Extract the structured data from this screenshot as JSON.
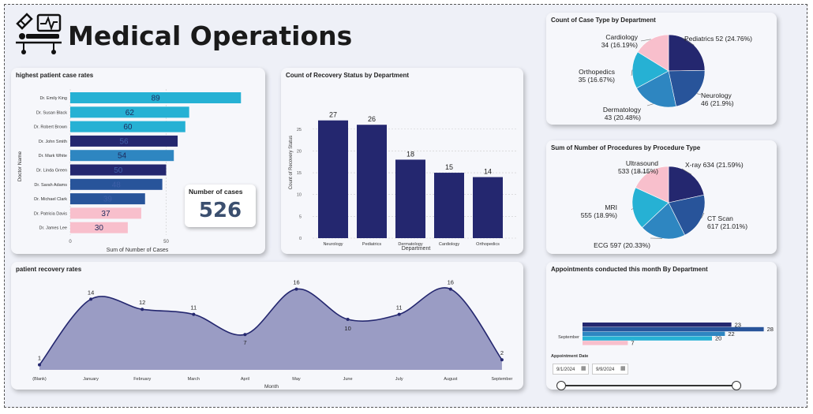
{
  "header": {
    "title": "Medical Operations"
  },
  "kpi": {
    "label": "Number of cases",
    "value": "526"
  },
  "slicer": {
    "label": "Appointment Date",
    "start": "9/1/2024",
    "end": "9/9/2024"
  },
  "colors": {
    "navy": "#24276f",
    "blue": "#28549a",
    "midblue": "#2e86c1",
    "cyan": "#26b1d4",
    "pink": "#f8bfcc",
    "area": "#9a9cc4"
  },
  "chart_data": [
    {
      "id": "cases_by_doctor",
      "type": "bar",
      "orientation": "horizontal",
      "title": "highest patient case rates",
      "xlabel": "Sum of Number of Cases",
      "ylabel": "Doctor Name",
      "xticks": [
        "0",
        "50"
      ],
      "categories": [
        "Dr. Emily King",
        "Dr. Susan Black",
        "Dr. Robert Brown",
        "Dr. John Smith",
        "Dr. Mark White",
        "Dr. Linda Green",
        "Dr. Sarah Adams",
        "Dr. Michael Clark",
        "Dr. Patricia Davis",
        "Dr. James Lee"
      ],
      "values": [
        89,
        62,
        60,
        56,
        54,
        50,
        48,
        39,
        37,
        30
      ],
      "colors": [
        "#26b1d4",
        "#26b1d4",
        "#26b1d4",
        "#24276f",
        "#2e86c1",
        "#24276f",
        "#28549a",
        "#28549a",
        "#f8bfcc",
        "#f8bfcc"
      ]
    },
    {
      "id": "recovery_by_dept",
      "type": "bar",
      "title": "Count of Recovery Status by Department",
      "xlabel": "Department",
      "ylabel": "Count of Recovery Status",
      "categories": [
        "Neurology",
        "Pediatrics",
        "Dermatology",
        "Cardiology",
        "Orthopedics"
      ],
      "values": [
        27,
        26,
        18,
        15,
        14
      ],
      "yticks": [
        "0",
        "5",
        "10",
        "15",
        "20",
        "25"
      ],
      "ylim": [
        0,
        30
      ]
    },
    {
      "id": "case_type_pie",
      "type": "pie",
      "title": "Count of Case Type by Department",
      "slices": [
        {
          "label": "Pediatrics",
          "value": 52,
          "pct": "24.76%",
          "text": "Pediatrics 52 (24.76%)",
          "color": "#24276f"
        },
        {
          "label": "Neurology",
          "value": 46,
          "pct": "21.9%",
          "l1": "Neurology",
          "l2": "46 (21.9%)",
          "color": "#28549a"
        },
        {
          "label": "Dermatology",
          "value": 43,
          "pct": "20.48%",
          "l1": "Dermatology",
          "l2": "43 (20.48%)",
          "color": "#2e86c1"
        },
        {
          "label": "Orthopedics",
          "value": 35,
          "pct": "16.67%",
          "l1": "Orthopedics",
          "l2": "35 (16.67%)",
          "color": "#26b1d4"
        },
        {
          "label": "Cardiology",
          "value": 34,
          "pct": "16.19%",
          "l1": "Cardiology",
          "l2": "34 (16.19%)",
          "color": "#f8bfcc"
        }
      ]
    },
    {
      "id": "procedures_pie",
      "type": "pie",
      "title": "Sum of Number of Procedures by Procedure Type",
      "slices": [
        {
          "label": "X-ray",
          "value": 634,
          "pct": "21.59%",
          "text": "X-ray 634 (21.59%)",
          "color": "#24276f"
        },
        {
          "label": "CT Scan",
          "value": 617,
          "pct": "21.01%",
          "l1": "CT Scan",
          "l2": "617 (21.01%)",
          "color": "#28549a"
        },
        {
          "label": "ECG",
          "value": 597,
          "pct": "20.33%",
          "text": "ECG 597 (20.33%)",
          "color": "#2e86c1"
        },
        {
          "label": "MRI",
          "value": 555,
          "pct": "18.9%",
          "l1": "MRI",
          "l2": "555 (18.9%)",
          "color": "#26b1d4"
        },
        {
          "label": "Ultrasound",
          "value": 533,
          "pct": "18.15%",
          "l1": "Ultrasound",
          "l2": "533 (18.15%)",
          "color": "#f8bfcc"
        }
      ]
    },
    {
      "id": "recovery_trend",
      "type": "area",
      "title": "patient recovery rates",
      "xlabel": "Month",
      "categories": [
        "(Blank)",
        "January",
        "February",
        "March",
        "April",
        "May",
        "June",
        "July",
        "August",
        "September"
      ],
      "values": [
        1,
        14,
        12,
        11,
        7,
        16,
        10,
        11,
        16,
        2
      ]
    },
    {
      "id": "appointments",
      "type": "bar",
      "orientation": "horizontal",
      "title": "Appointments conducted this month By Department",
      "category": "September",
      "values": [
        23,
        28,
        22,
        20,
        7
      ],
      "colors": [
        "#24276f",
        "#28549a",
        "#2e86c1",
        "#26b1d4",
        "#f8bfcc"
      ]
    }
  ]
}
